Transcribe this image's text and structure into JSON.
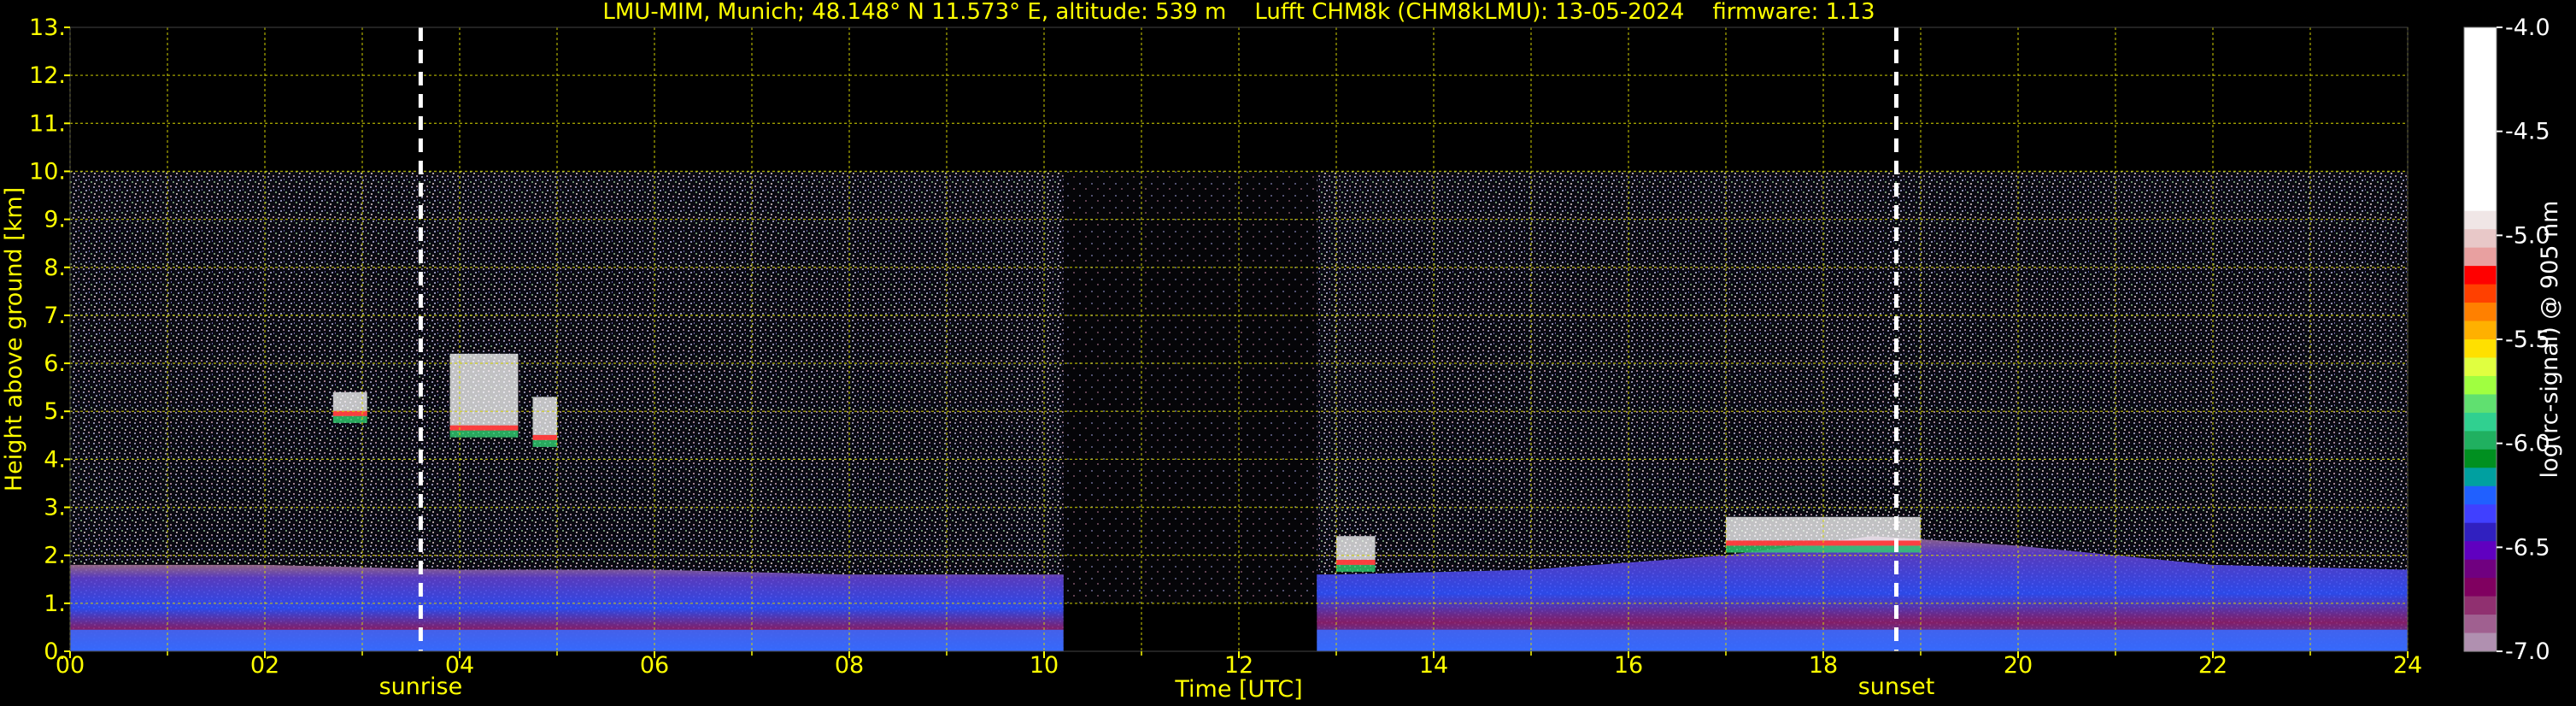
{
  "chart_data": {
    "type": "heatmap",
    "title": "LMU-MIM, Munich; 48.148° N 11.573° E, altitude: 539 m    Lufft CHM8k (CHM8kLMU): 13-05-2024    firmware: 1.13",
    "xlabel": "Time [UTC]",
    "ylabel": "Height above ground [km]",
    "xlim": [
      0,
      24
    ],
    "ylim": [
      0,
      13
    ],
    "x_ticks": [
      "00",
      "02",
      "04",
      "06",
      "08",
      "10",
      "12",
      "14",
      "16",
      "18",
      "20",
      "22",
      "24"
    ],
    "y_ticks": [
      "0.",
      "1.",
      "2.",
      "3.",
      "4.",
      "5.",
      "6.",
      "7.",
      "8.",
      "9.",
      "10.",
      "11.",
      "12.",
      "13."
    ],
    "grid": true,
    "signal_top_km": 10,
    "data_gap_utc": [
      10.2,
      12.8
    ],
    "sunrise_utc": 3.6,
    "sunset_utc": 18.75,
    "sunrise_label": "sunrise",
    "sunset_label": "sunset",
    "colorbar": {
      "label": "log(rc-signal) @ 905 nm",
      "range": [
        -7.0,
        -4.0
      ],
      "ticks": [
        "-4.0",
        "-4.5",
        "-5.0",
        "-5.5",
        "-6.0",
        "-6.5",
        "-7.0"
      ],
      "colors": [
        "#ffffff",
        "#ffffff",
        "#ffffff",
        "#ffffff",
        "#ffffff",
        "#ffffff",
        "#ffffff",
        "#ffffff",
        "#ffffff",
        "#ffffff",
        "#f0e6e6",
        "#e8c8c8",
        "#e8a0a0",
        "#ff0000",
        "#ff4000",
        "#ff8000",
        "#ffb000",
        "#ffe000",
        "#e0ff40",
        "#a0ff40",
        "#60e070",
        "#30d090",
        "#20b060",
        "#009020",
        "#00a0a0",
        "#2060ff",
        "#4040ff",
        "#3020c0",
        "#6000c0",
        "#700080",
        "#800060",
        "#903070",
        "#a06090",
        "#b090b0"
      ]
    },
    "boundary_layer": [
      {
        "x": 0,
        "y": 1.8
      },
      {
        "x": 2,
        "y": 1.8
      },
      {
        "x": 4,
        "y": 1.7
      },
      {
        "x": 6,
        "y": 1.7
      },
      {
        "x": 8,
        "y": 1.6
      },
      {
        "x": 10,
        "y": 1.6
      },
      {
        "x": 13,
        "y": 1.6
      },
      {
        "x": 15,
        "y": 1.7
      },
      {
        "x": 17,
        "y": 2.0
      },
      {
        "x": 18.5,
        "y": 2.4
      },
      {
        "x": 20,
        "y": 2.2
      },
      {
        "x": 22,
        "y": 1.8
      },
      {
        "x": 24,
        "y": 1.7
      }
    ],
    "cloud_patches": [
      {
        "x0": 2.7,
        "x1": 3.05,
        "y0": 4.9,
        "y1": 5.4
      },
      {
        "x0": 3.9,
        "x1": 4.6,
        "y0": 4.6,
        "y1": 6.2
      },
      {
        "x0": 4.75,
        "x1": 5.0,
        "y0": 4.4,
        "y1": 5.3
      },
      {
        "x0": 13.0,
        "x1": 13.4,
        "y0": 1.8,
        "y1": 2.4
      },
      {
        "x0": 17.0,
        "x1": 19.0,
        "y0": 2.2,
        "y1": 2.8
      }
    ]
  }
}
